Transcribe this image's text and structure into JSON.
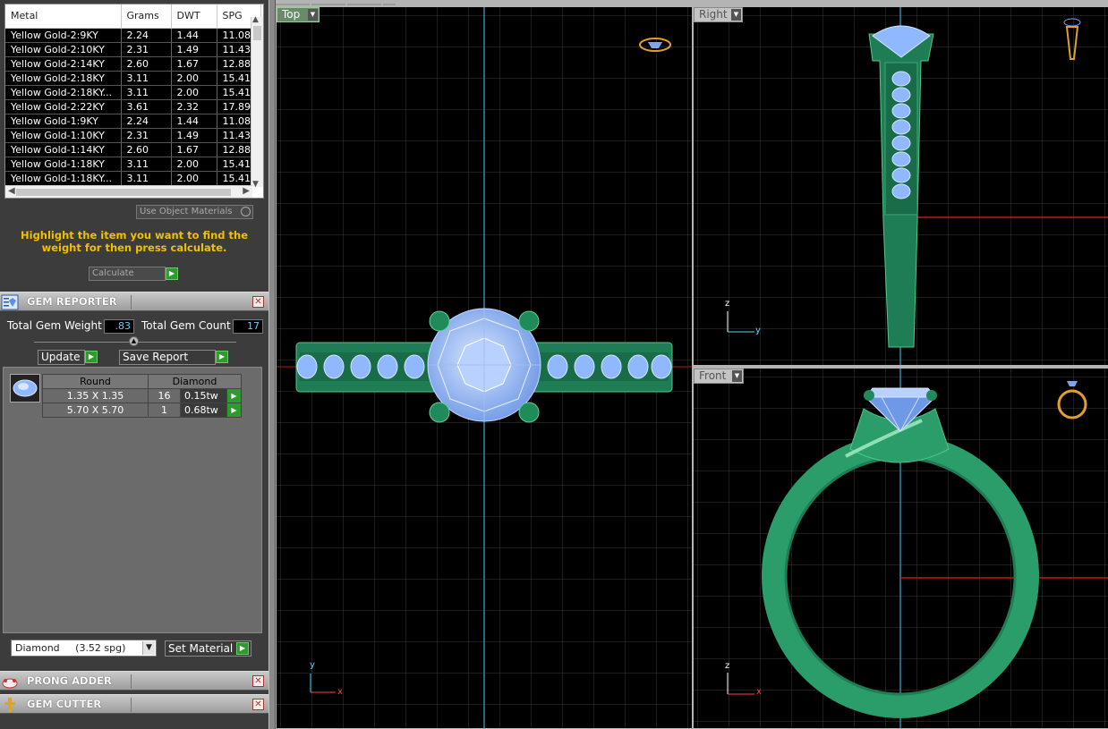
{
  "metals_table": {
    "headers": [
      "Metal",
      "Grams",
      "DWT",
      "SPG"
    ],
    "rows": [
      [
        "Yellow Gold-2:9KY",
        "2.24",
        "1.44",
        "11.08"
      ],
      [
        "Yellow Gold-2:10KY",
        "2.31",
        "1.49",
        "11.43"
      ],
      [
        "Yellow Gold-2:14KY",
        "2.60",
        "1.67",
        "12.88"
      ],
      [
        "Yellow Gold-2:18KY",
        "3.11",
        "2.00",
        "15.41"
      ],
      [
        "Yellow Gold-2:18KY...",
        "3.11",
        "2.00",
        "15.41"
      ],
      [
        "Yellow Gold-2:22KY",
        "3.61",
        "2.32",
        "17.89"
      ],
      [
        "Yellow Gold-1:9KY",
        "2.24",
        "1.44",
        "11.08"
      ],
      [
        "Yellow Gold-1:10KY",
        "2.31",
        "1.49",
        "11.43"
      ],
      [
        "Yellow Gold-1:14KY",
        "2.60",
        "1.67",
        "12.88"
      ],
      [
        "Yellow Gold-1:18KY",
        "3.11",
        "2.00",
        "15.41"
      ],
      [
        "Yellow Gold-1:18KY...",
        "3.11",
        "2.00",
        "15.41"
      ]
    ]
  },
  "use_object_materials_label": "Use Object Materials",
  "highlight_text": "Highlight the item you want to find the weight for then press calculate.",
  "calculate_label": "Calculate",
  "gem_reporter": {
    "title": "GEM REPORTER",
    "total_weight_label": "Total Gem Weight",
    "total_weight_value": ".83",
    "total_count_label": "Total Gem Count",
    "total_count_value": "17",
    "update_label": "Update",
    "save_report_label": "Save Report",
    "table_headers": [
      "Round",
      "Diamond"
    ],
    "rows": [
      {
        "size": "1.35 X 1.35",
        "count": "16",
        "tw": "0.15tw"
      },
      {
        "size": "5.70 X 5.70",
        "count": "1",
        "tw": "0.68tw"
      }
    ],
    "material_select": "Diamond     (3.52 spg)",
    "set_material_label": "Set Material"
  },
  "prong_adder": {
    "title": "PRONG ADDER"
  },
  "gem_cutter": {
    "title": "GEM CUTTER"
  },
  "viewports": {
    "top": {
      "label": "Top"
    },
    "right": {
      "label": "Right"
    },
    "front": {
      "label": "Front"
    }
  },
  "axes": {
    "x": "x",
    "y": "y",
    "z": "z"
  },
  "colors": {
    "metal": "#2a9d6a",
    "gem": "#8fb8ff",
    "grid": "#3a3a3a",
    "highlight_text": "#f2c000"
  }
}
